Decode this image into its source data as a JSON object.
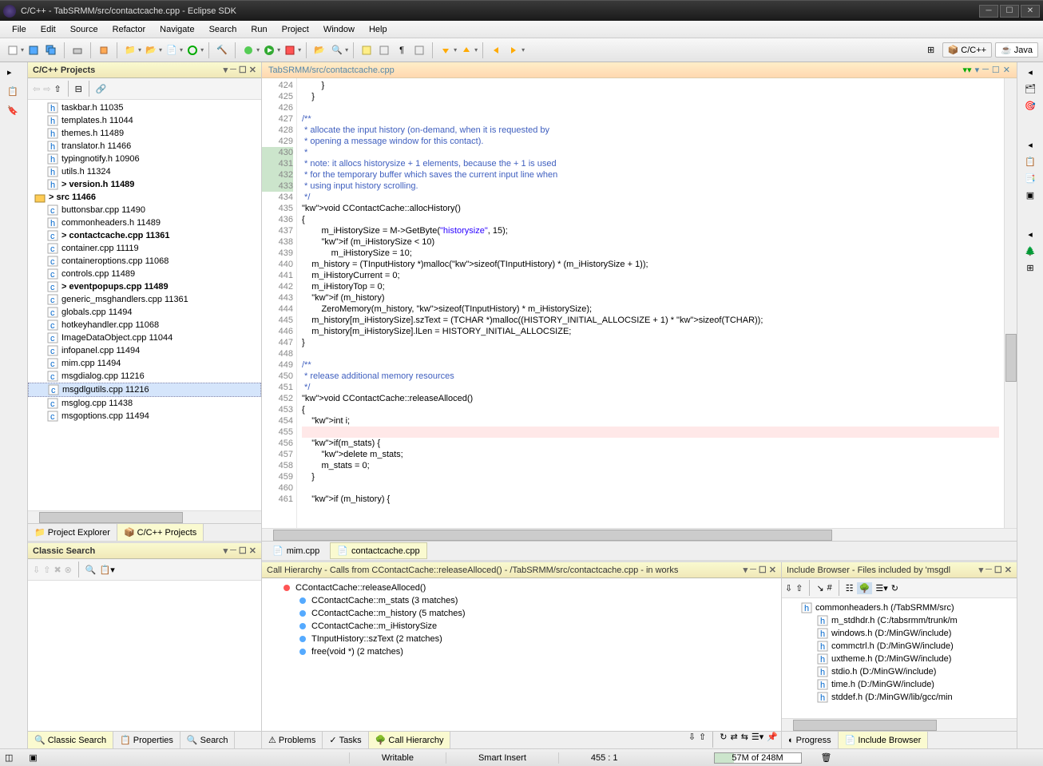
{
  "window": {
    "title": "C/C++ - TabSRMM/src/contactcache.cpp - Eclipse SDK"
  },
  "menu": [
    "File",
    "Edit",
    "Source",
    "Refactor",
    "Navigate",
    "Search",
    "Run",
    "Project",
    "Window",
    "Help"
  ],
  "perspectives": {
    "cpp": "C/C++",
    "java": "Java"
  },
  "projects_view": {
    "title": "C/C++ Projects",
    "items": [
      {
        "name": "taskbar.h 11035",
        "icon": "h"
      },
      {
        "name": "templates.h 11044",
        "icon": "h"
      },
      {
        "name": "themes.h 11489",
        "icon": "h"
      },
      {
        "name": "translator.h 11466",
        "icon": "h"
      },
      {
        "name": "typingnotify.h 10906",
        "icon": "h"
      },
      {
        "name": "utils.h 11324",
        "icon": "h"
      },
      {
        "name": "> version.h 11489",
        "icon": "h",
        "bold": true
      },
      {
        "name": "> src 11466",
        "icon": "folder",
        "bold": true,
        "folder": true
      },
      {
        "name": "buttonsbar.cpp 11490",
        "icon": "c"
      },
      {
        "name": "commonheaders.h 11489",
        "icon": "h"
      },
      {
        "name": "> contactcache.cpp 11361",
        "icon": "c",
        "bold": true
      },
      {
        "name": "container.cpp 11119",
        "icon": "c"
      },
      {
        "name": "containeroptions.cpp 11068",
        "icon": "c"
      },
      {
        "name": "controls.cpp 11489",
        "icon": "c"
      },
      {
        "name": "> eventpopups.cpp 11489",
        "icon": "c",
        "bold": true
      },
      {
        "name": "generic_msghandlers.cpp 11361",
        "icon": "c"
      },
      {
        "name": "globals.cpp 11494",
        "icon": "c"
      },
      {
        "name": "hotkeyhandler.cpp 11068",
        "icon": "c"
      },
      {
        "name": "ImageDataObject.cpp 11044",
        "icon": "c"
      },
      {
        "name": "infopanel.cpp 11494",
        "icon": "c"
      },
      {
        "name": "mim.cpp 11494",
        "icon": "c"
      },
      {
        "name": "msgdialog.cpp 11216",
        "icon": "c"
      },
      {
        "name": "msgdlgutils.cpp 11216",
        "icon": "c",
        "selected": true
      },
      {
        "name": "msglog.cpp 11438",
        "icon": "c"
      },
      {
        "name": "msgoptions.cpp 11494",
        "icon": "c"
      }
    ],
    "bottom_tabs": {
      "pe": "Project Explorer",
      "cpp": "C/C++ Projects"
    }
  },
  "classic_search": {
    "title": "Classic Search",
    "bottom_tabs": {
      "cs": "Classic Search",
      "prop": "Properties",
      "sr": "Search"
    }
  },
  "editor": {
    "tab_title": "TabSRMM/src/contactcache.cpp",
    "tabs": {
      "mim": "mim.cpp",
      "cc": "contactcache.cpp"
    },
    "lines": [
      {
        "n": 424,
        "t": "        }"
      },
      {
        "n": 425,
        "t": "    }"
      },
      {
        "n": 426,
        "t": ""
      },
      {
        "n": 427,
        "t": "/**"
      },
      {
        "n": 428,
        "t": " * allocate the input history (on-demand, when it is requested by"
      },
      {
        "n": 429,
        "t": " * opening a message window for this contact)."
      },
      {
        "n": 430,
        "t": " *",
        "m": 1
      },
      {
        "n": 431,
        "t": " * note: it allocs historysize + 1 elements, because the + 1 is used",
        "m": 1
      },
      {
        "n": 432,
        "t": " * for the temporary buffer which saves the current input line when",
        "m": 1
      },
      {
        "n": 433,
        "t": " * using input history scrolling.",
        "m": 1
      },
      {
        "n": 434,
        "t": " */"
      },
      {
        "n": 435,
        "t": "void CContactCache::allocHistory()"
      },
      {
        "n": 436,
        "t": "{"
      },
      {
        "n": 437,
        "t": "        m_iHistorySize = M->GetByte(\"historysize\", 15);"
      },
      {
        "n": 438,
        "t": "        if (m_iHistorySize < 10)"
      },
      {
        "n": 439,
        "t": "            m_iHistorySize = 10;"
      },
      {
        "n": 440,
        "t": "    m_history = (TInputHistory *)malloc(sizeof(TInputHistory) * (m_iHistorySize + 1));"
      },
      {
        "n": 441,
        "t": "    m_iHistoryCurrent = 0;"
      },
      {
        "n": 442,
        "t": "    m_iHistoryTop = 0;"
      },
      {
        "n": 443,
        "t": "    if (m_history)"
      },
      {
        "n": 444,
        "t": "        ZeroMemory(m_history, sizeof(TInputHistory) * m_iHistorySize);"
      },
      {
        "n": 445,
        "t": "    m_history[m_iHistorySize].szText = (TCHAR *)malloc((HISTORY_INITIAL_ALLOCSIZE + 1) * sizeof(TCHAR));"
      },
      {
        "n": 446,
        "t": "    m_history[m_iHistorySize].lLen = HISTORY_INITIAL_ALLOCSIZE;"
      },
      {
        "n": 447,
        "t": "}"
      },
      {
        "n": 448,
        "t": ""
      },
      {
        "n": 449,
        "t": "/**"
      },
      {
        "n": 450,
        "t": " * release additional memory resources"
      },
      {
        "n": 451,
        "t": " */"
      },
      {
        "n": 452,
        "t": "void CContactCache::releaseAlloced()"
      },
      {
        "n": 453,
        "t": "{"
      },
      {
        "n": 454,
        "t": "    int i;"
      },
      {
        "n": 455,
        "t": "",
        "hl": 1
      },
      {
        "n": 456,
        "t": "    if(m_stats) {"
      },
      {
        "n": 457,
        "t": "        delete m_stats;"
      },
      {
        "n": 458,
        "t": "        m_stats = 0;"
      },
      {
        "n": 459,
        "t": "    }"
      },
      {
        "n": 460,
        "t": ""
      },
      {
        "n": 461,
        "t": "    if (m_history) {"
      }
    ]
  },
  "call_hierarchy": {
    "title": "Call Hierarchy - Calls from CContactCache::releaseAlloced() - /TabSRMM/src/contactcache.cpp - in works",
    "items": [
      {
        "t": "CContactCache::releaseAlloced()",
        "i": 0
      },
      {
        "t": "CContactCache::m_stats (3 matches)",
        "i": 1
      },
      {
        "t": "CContactCache::m_history (5 matches)",
        "i": 1
      },
      {
        "t": "CContactCache::m_iHistorySize",
        "i": 1
      },
      {
        "t": "TInputHistory::szText (2 matches)",
        "i": 1
      },
      {
        "t": "free(void *) (2 matches)",
        "i": 1
      }
    ],
    "bottom_tabs": {
      "prob": "Problems",
      "tasks": "Tasks",
      "ch": "Call Hierarchy"
    }
  },
  "include_browser": {
    "title": "Include Browser - Files included by 'msgdl",
    "items": [
      "commonheaders.h (/TabSRMM/src)",
      "m_stdhdr.h (C:/tabsrmm/trunk/m",
      "windows.h (D:/MinGW/include)",
      "commctrl.h (D:/MinGW/include)",
      "uxtheme.h (D:/MinGW/include)",
      "stdio.h (D:/MinGW/include)",
      "time.h (D:/MinGW/include)",
      "stddef.h (D:/MinGW/lib/gcc/min"
    ],
    "bottom_tabs": {
      "prog": "Progress",
      "ib": "Include Browser"
    }
  },
  "statusbar": {
    "writable": "Writable",
    "insert": "Smart Insert",
    "pos": "455 : 1",
    "memory": "57M of 248M"
  }
}
